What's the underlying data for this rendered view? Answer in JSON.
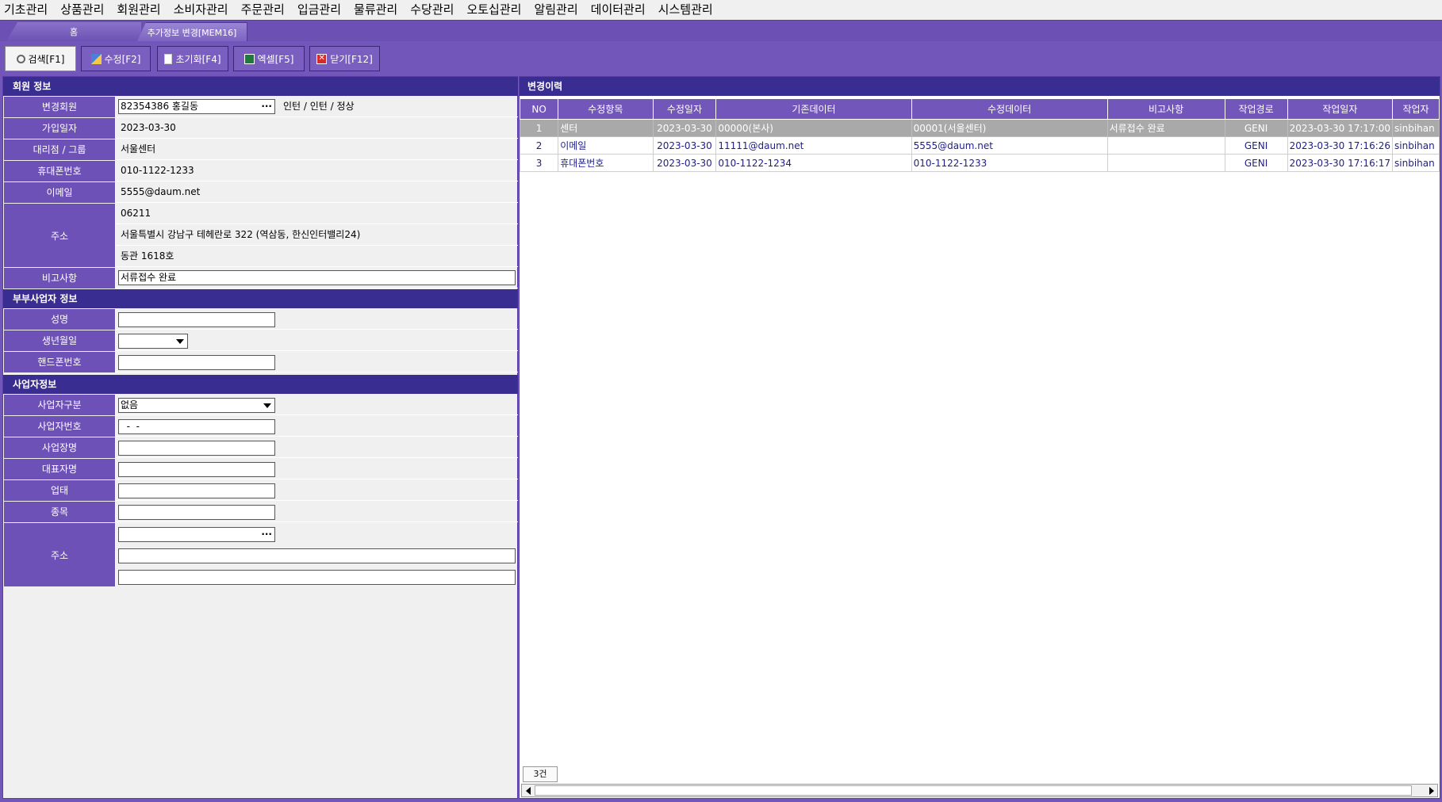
{
  "menu": [
    "기초관리",
    "상품관리",
    "회원관리",
    "소비자관리",
    "주문관리",
    "입금관리",
    "물류관리",
    "수당관리",
    "오토십관리",
    "알림관리",
    "데이터관리",
    "시스템관리"
  ],
  "tabs": {
    "home": "홈",
    "active": "추가정보 변경[MEM16]"
  },
  "toolbar": {
    "search": "검색[F1]",
    "edit": "수정[F2]",
    "reset": "초기화[F4]",
    "excel": "엑셀[F5]",
    "close": "닫기[F12]"
  },
  "member": {
    "section_title": "회원 정보",
    "labels": {
      "member": "변경회원",
      "join_date": "가입일자",
      "agency": "대리점 / 그룹",
      "mobile": "휴대폰번호",
      "email": "이메일",
      "address": "주소",
      "note": "비고사항"
    },
    "member_value": "82354386 홍길동",
    "member_status": "인턴 / 인턴 / 정상",
    "join_date": "2023-03-30",
    "agency": "서울센터",
    "mobile": "010-1122-1233",
    "email": "5555@daum.net",
    "zip": "06211",
    "addr1": "서울특별시 강남구 테헤란로 322 (역삼동, 한신인터밸리24)",
    "addr2": "동관 1618호",
    "note": "서류접수 완료"
  },
  "spouse": {
    "section_title": "부부사업자 정보",
    "labels": {
      "name": "성명",
      "birth": "생년월일",
      "phone": "핸드폰번호"
    },
    "name": "",
    "birth": "",
    "phone": ""
  },
  "business": {
    "section_title": "사업자정보",
    "labels": {
      "type": "사업자구분",
      "number": "사업자번호",
      "name": "사업장명",
      "ceo": "대표자명",
      "category": "업태",
      "item": "종목",
      "address": "주소"
    },
    "type": "없음",
    "number": "  -  -",
    "biz_name": "",
    "ceo": "",
    "category": "",
    "item": "",
    "zip": "",
    "addr1": "",
    "addr2": ""
  },
  "history": {
    "title": "변경이력",
    "columns": [
      "NO",
      "수정항목",
      "수정일자",
      "기존데이터",
      "수정데이터",
      "비고사항",
      "작업경로",
      "작업일자",
      "작업자"
    ],
    "rows": [
      {
        "no": "1",
        "item": "센터",
        "date": "2023-03-30",
        "old": "00000(본사)",
        "new": "00001(서울센터)",
        "note": "서류접수 완료",
        "path": "GENI",
        "work_date": "2023-03-30 17:17:00",
        "worker": "sinbihan"
      },
      {
        "no": "2",
        "item": "이메일",
        "date": "2023-03-30",
        "old": "11111@daum.net",
        "new": "5555@daum.net",
        "note": "",
        "path": "GENI",
        "work_date": "2023-03-30 17:16:26",
        "worker": "sinbihan"
      },
      {
        "no": "3",
        "item": "휴대폰번호",
        "date": "2023-03-30",
        "old": "010-1122-1234",
        "new": "010-1122-1233",
        "note": "",
        "path": "GENI",
        "work_date": "2023-03-30 17:16:17",
        "worker": "sinbihan"
      }
    ],
    "count": "3건"
  },
  "colors": {
    "accent": "#7256b9",
    "header": "#3a2d91",
    "label": "#6d51b6",
    "selected_row": "#a9a9a9"
  }
}
